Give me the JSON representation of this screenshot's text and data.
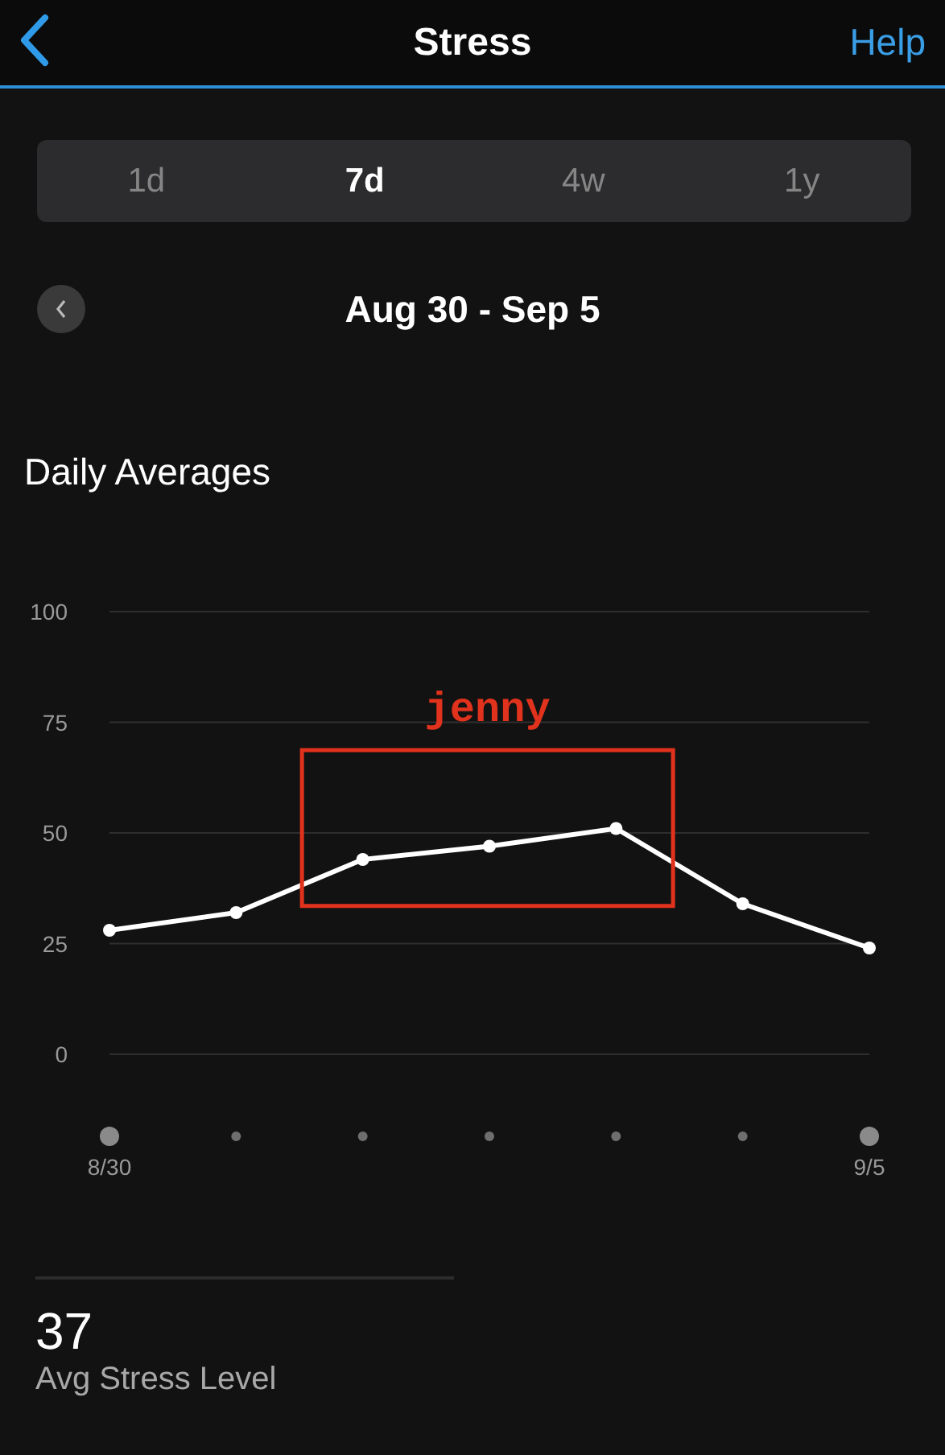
{
  "header": {
    "title": "Stress",
    "help": "Help"
  },
  "range_tabs": [
    {
      "label": "1d",
      "selected": false
    },
    {
      "label": "7d",
      "selected": true
    },
    {
      "label": "4w",
      "selected": false
    },
    {
      "label": "1y",
      "selected": false
    }
  ],
  "date_range": "Aug 30 - Sep 5",
  "section_title": "Daily Averages",
  "chart_data": {
    "type": "line",
    "categories": [
      "8/30",
      null,
      null,
      null,
      null,
      null,
      "9/5"
    ],
    "grid": true,
    "series": [
      {
        "color": "#ffffff",
        "marker": "circle",
        "values": [
          28,
          32,
          44,
          47,
          51,
          34,
          24
        ]
      }
    ],
    "ylim": [
      0,
      100
    ],
    "yticks": [
      0,
      25,
      50,
      75,
      100
    ],
    "annotations": [
      {
        "text": "jenny"
      }
    ]
  },
  "summary": {
    "value": "37",
    "label": "Avg Stress Level"
  }
}
